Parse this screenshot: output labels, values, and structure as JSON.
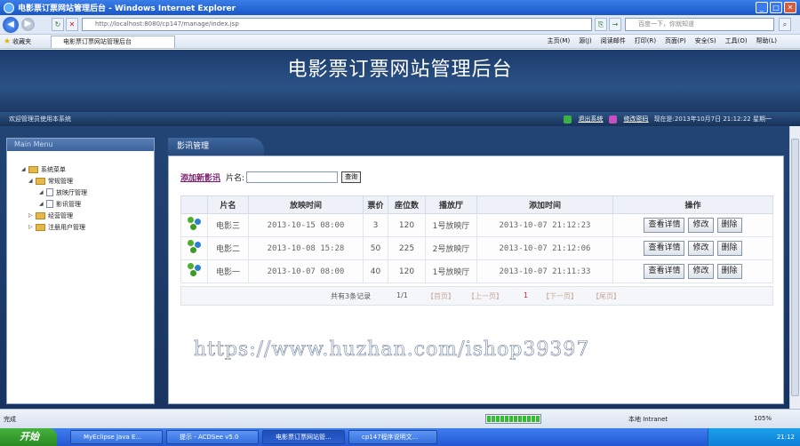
{
  "browser": {
    "window_title": "电影票订票网站管理后台 - Windows Internet Explorer",
    "address": "http://localhost:8080/cp147/manage/index.jsp",
    "search_placeholder": "百度一下，你就知道",
    "favorites_label": "收藏夹",
    "tab_title": "电影票订票网站管理后台",
    "commands": [
      "主页(M)",
      "源(J)",
      "阅读邮件",
      "打印(R)",
      "页面(P)",
      "安全(S)",
      "工具(O)",
      "帮助(L)"
    ],
    "status_text": "完成",
    "zone": "本地 Intranet",
    "zoom": "105%",
    "load_progress": 1.0
  },
  "site": {
    "title": "电影票订票网站管理后台",
    "welcome": "欢迎管理员使用本系统",
    "logout": "退出系统",
    "change_password": "修改密码",
    "now_text": "现在是:2013年10月7日  21:12:22 星期一"
  },
  "menu": {
    "head": "Main Menu",
    "root": "系统菜单",
    "group1": "常规管理",
    "item_hall": "放映厅管理",
    "item_film": "影讯管理",
    "group2": "经营管理",
    "group3": "注册用户管理"
  },
  "content": {
    "tab": "影讯管理",
    "add_link": "添加新影讯",
    "name_label": "片名:",
    "query_button": "查询",
    "columns": [
      "",
      "片名",
      "放映时间",
      "票价",
      "座位数",
      "播放厅",
      "添加时间",
      "操作"
    ],
    "rows": [
      {
        "name": "电影三",
        "show_time": "2013-10-15 08:00",
        "price": "3",
        "seats": "120",
        "hall": "1号放映厅",
        "added": "2013-10-07 21:12:23"
      },
      {
        "name": "电影二",
        "show_time": "2013-10-08 15:28",
        "price": "50",
        "seats": "225",
        "hall": "2号放映厅",
        "added": "2013-10-07 21:12:06"
      },
      {
        "name": "电影一",
        "show_time": "2013-10-07 08:00",
        "price": "40",
        "seats": "120",
        "hall": "1号放映厅",
        "added": "2013-10-07 21:11:33"
      }
    ],
    "btn_detail": "查看详情",
    "btn_edit": "修改",
    "btn_delete": "删除",
    "pager": {
      "total": "共有3条记录",
      "page": "1/1",
      "first": "【首页】",
      "prev": "【上一页】",
      "current": "1",
      "next": "【下一页】",
      "last": "【尾页】"
    }
  },
  "watermark": "https://www.huzhan.com/ishop39397",
  "taskbar": {
    "start": "开始",
    "tasks": [
      "MyEclipse Java E...",
      "提示 - ACDSee v5.0",
      "电影票订票网站管...",
      "cp147程序说明文..."
    ],
    "clock": "21:12"
  }
}
